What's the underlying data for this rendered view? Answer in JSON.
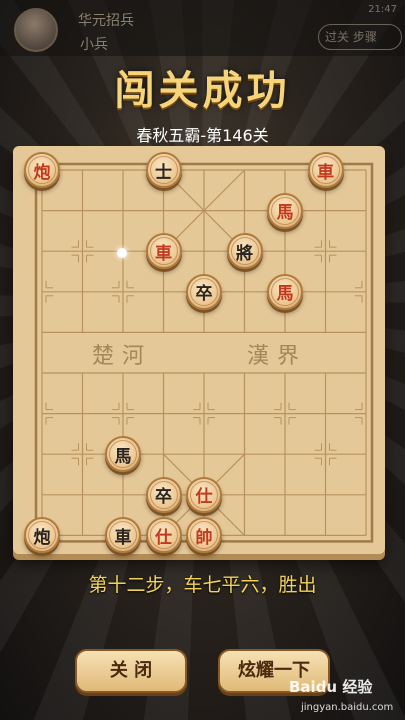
{
  "status": {
    "player_name": "华元招兵",
    "player_rank": "小兵",
    "time": "21:47",
    "skip_label": "过关 步骤"
  },
  "header": {
    "title": "闯关成功",
    "level": "春秋五霸-第146关"
  },
  "board": {
    "river_left": "楚河",
    "river_right": "漢界",
    "pieces": [
      {
        "char": "炮",
        "side": "red",
        "col": 0,
        "row": 0
      },
      {
        "char": "士",
        "side": "black",
        "col": 3,
        "row": 0
      },
      {
        "char": "車",
        "side": "red",
        "col": 7,
        "row": 0
      },
      {
        "char": "馬",
        "side": "red",
        "col": 6,
        "row": 1
      },
      {
        "char": "車",
        "side": "red",
        "col": 3,
        "row": 2
      },
      {
        "char": "將",
        "side": "black",
        "col": 5,
        "row": 2
      },
      {
        "char": "卒",
        "side": "black",
        "col": 4,
        "row": 3
      },
      {
        "char": "馬",
        "side": "red",
        "col": 6,
        "row": 3
      },
      {
        "char": "馬",
        "side": "black",
        "col": 2,
        "row": 7
      },
      {
        "char": "卒",
        "side": "black",
        "col": 3,
        "row": 8
      },
      {
        "char": "仕",
        "side": "red",
        "col": 4,
        "row": 8
      },
      {
        "char": "炮",
        "side": "black",
        "col": 0,
        "row": 9
      },
      {
        "char": "車",
        "side": "black",
        "col": 2,
        "row": 9
      },
      {
        "char": "仕",
        "side": "red",
        "col": 3,
        "row": 9
      },
      {
        "char": "帥",
        "side": "red",
        "col": 4,
        "row": 9
      }
    ]
  },
  "move_text": "第十二步，车七平六，胜出",
  "buttons": {
    "close_label": "关 闭",
    "show_label": "炫耀一下"
  },
  "watermark": {
    "brand": "Baidu 经验",
    "url": "jingyan.baidu.com"
  },
  "colors": {
    "red_piece": "#c23a1e",
    "black_piece": "#2a2420",
    "title_gold": "#f5d47a",
    "move_text": "#f2d25a"
  }
}
